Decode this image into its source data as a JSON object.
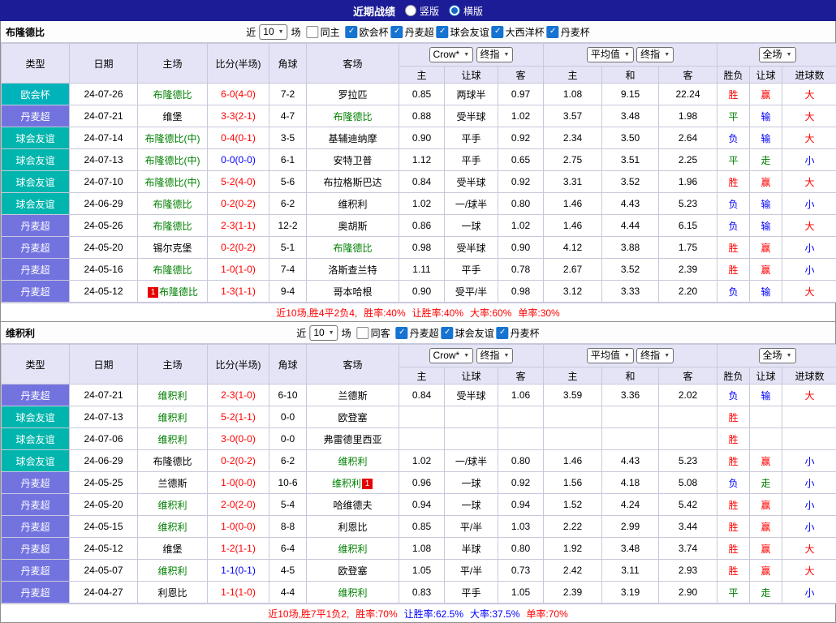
{
  "icons": {
    "dropdown_arrow": "▼",
    "check": "✓"
  },
  "topbar": {
    "title": "近期战绩",
    "layout_options": [
      {
        "label": "竖版",
        "selected": false
      },
      {
        "label": "横版",
        "selected": true
      }
    ]
  },
  "labels": {
    "near": "近",
    "matches": "场"
  },
  "table_header": {
    "col_type": "类型",
    "col_date": "日期",
    "col_home": "主场",
    "col_score": "比分(半场)",
    "col_corner": "角球",
    "col_away": "客场",
    "odds_select1": "Crow*",
    "odds_select2": "终指",
    "avg_select1": "平均值",
    "avg_select2": "终指",
    "scope_select": "全场",
    "odds_sub": [
      "主",
      "让球",
      "客"
    ],
    "avg_sub": [
      "主",
      "和",
      "客"
    ],
    "result_sub": [
      "胜负",
      "让球",
      "进球数"
    ]
  },
  "sections": [
    {
      "team": "布隆德比",
      "filter": {
        "period": "10",
        "same_label": "同主",
        "same_checked": false,
        "leagues": [
          {
            "label": "欧会杯",
            "checked": true
          },
          {
            "label": "丹麦超",
            "checked": true
          },
          {
            "label": "球会友谊",
            "checked": true
          },
          {
            "label": "大西洋杯",
            "checked": true
          },
          {
            "label": "丹麦杯",
            "checked": true
          }
        ]
      },
      "rows": [
        {
          "type": "欧会杯",
          "type_color": "#00b3bb",
          "date": "24-07-26",
          "home": "布隆德比",
          "home_color": "#008000",
          "score": "6-0(4-0)",
          "score_color": "#ff0000",
          "corner": "7-2",
          "away": "罗拉匹",
          "hc_home": "0.85",
          "handicap": "两球半",
          "hc_away": "0.97",
          "avg_home": "1.08",
          "avg_draw": "9.15",
          "avg_away": "22.24",
          "wdl": "胜",
          "wdl_color": "#ff0000",
          "hc_result": "赢",
          "hc_result_color": "#ff0000",
          "ou": "大",
          "ou_color": "#ff0000"
        },
        {
          "type": "丹麦超",
          "type_color": "#7373e0",
          "date": "24-07-21",
          "home": "维堡",
          "score": "3-3(2-1)",
          "score_color": "#ff0000",
          "corner": "4-7",
          "away": "布隆德比",
          "away_color": "#008000",
          "hc_home": "0.88",
          "handicap": "受半球",
          "hc_away": "1.02",
          "avg_home": "3.57",
          "avg_draw": "3.48",
          "avg_away": "1.98",
          "wdl": "平",
          "wdl_color": "#008000",
          "hc_result": "输",
          "hc_result_color": "#0000ff",
          "ou": "大",
          "ou_color": "#ff0000"
        },
        {
          "type": "球会友谊",
          "type_color": "#00b5ad",
          "date": "24-07-14",
          "home": "布隆德比(中)",
          "home_color": "#008000",
          "score": "0-4(0-1)",
          "score_color": "#ff0000",
          "corner": "3-5",
          "away": "基辅迪纳摩",
          "hc_home": "0.90",
          "handicap": "平手",
          "hc_away": "0.92",
          "avg_home": "2.34",
          "avg_draw": "3.50",
          "avg_away": "2.64",
          "wdl": "负",
          "wdl_color": "#0000ff",
          "hc_result": "输",
          "hc_result_color": "#0000ff",
          "ou": "大",
          "ou_color": "#ff0000"
        },
        {
          "type": "球会友谊",
          "type_color": "#00b5ad",
          "date": "24-07-13",
          "home": "布隆德比(中)",
          "home_color": "#008000",
          "score": "0-0(0-0)",
          "score_color": "#0000ff",
          "corner": "6-1",
          "away": "安特卫普",
          "hc_home": "1.12",
          "handicap": "平手",
          "hc_away": "0.65",
          "avg_home": "2.75",
          "avg_draw": "3.51",
          "avg_away": "2.25",
          "wdl": "平",
          "wdl_color": "#008000",
          "hc_result": "走",
          "hc_result_color": "#008000",
          "ou": "小",
          "ou_color": "#0000ff"
        },
        {
          "type": "球会友谊",
          "type_color": "#00b5ad",
          "date": "24-07-10",
          "home": "布隆德比(中)",
          "home_color": "#008000",
          "score": "5-2(4-0)",
          "score_color": "#ff0000",
          "corner": "5-6",
          "away": "布拉格斯巴达",
          "hc_home": "0.84",
          "handicap": "受半球",
          "hc_away": "0.92",
          "avg_home": "3.31",
          "avg_draw": "3.52",
          "avg_away": "1.96",
          "wdl": "胜",
          "wdl_color": "#ff0000",
          "hc_result": "赢",
          "hc_result_color": "#ff0000",
          "ou": "大",
          "ou_color": "#ff0000"
        },
        {
          "type": "球会友谊",
          "type_color": "#00b5ad",
          "date": "24-06-29",
          "home": "布隆德比",
          "home_color": "#008000",
          "score": "0-2(0-2)",
          "score_color": "#ff0000",
          "corner": "6-2",
          "away": "维积利",
          "hc_home": "1.02",
          "handicap": "一/球半",
          "hc_away": "0.80",
          "avg_home": "1.46",
          "avg_draw": "4.43",
          "avg_away": "5.23",
          "wdl": "负",
          "wdl_color": "#0000ff",
          "hc_result": "输",
          "hc_result_color": "#0000ff",
          "ou": "小",
          "ou_color": "#0000ff"
        },
        {
          "type": "丹麦超",
          "type_color": "#7373e0",
          "date": "24-05-26",
          "home": "布隆德比",
          "home_color": "#008000",
          "score": "2-3(1-1)",
          "score_color": "#ff0000",
          "corner": "12-2",
          "away": "奥胡斯",
          "hc_home": "0.86",
          "handicap": "一球",
          "hc_away": "1.02",
          "avg_home": "1.46",
          "avg_draw": "4.44",
          "avg_away": "6.15",
          "wdl": "负",
          "wdl_color": "#0000ff",
          "hc_result": "输",
          "hc_result_color": "#0000ff",
          "ou": "大",
          "ou_color": "#ff0000"
        },
        {
          "type": "丹麦超",
          "type_color": "#7373e0",
          "date": "24-05-20",
          "home": "锡尔克堡",
          "score": "0-2(0-2)",
          "score_color": "#ff0000",
          "corner": "5-1",
          "away": "布隆德比",
          "away_color": "#008000",
          "hc_home": "0.98",
          "handicap": "受半球",
          "hc_away": "0.90",
          "avg_home": "4.12",
          "avg_draw": "3.88",
          "avg_away": "1.75",
          "wdl": "胜",
          "wdl_color": "#ff0000",
          "hc_result": "赢",
          "hc_result_color": "#ff0000",
          "ou": "小",
          "ou_color": "#0000ff"
        },
        {
          "type": "丹麦超",
          "type_color": "#7373e0",
          "date": "24-05-16",
          "home": "布隆德比",
          "home_color": "#008000",
          "score": "1-0(1-0)",
          "score_color": "#ff0000",
          "corner": "7-4",
          "away": "洛斯查兰特",
          "hc_home": "1.11",
          "handicap": "平手",
          "hc_away": "0.78",
          "avg_home": "2.67",
          "avg_draw": "3.52",
          "avg_away": "2.39",
          "wdl": "胜",
          "wdl_color": "#ff0000",
          "hc_result": "赢",
          "hc_result_color": "#ff0000",
          "ou": "小",
          "ou_color": "#0000ff"
        },
        {
          "type": "丹麦超",
          "type_color": "#7373e0",
          "date": "24-05-12",
          "home_pre": "1",
          "home": "布隆德比",
          "home_color": "#008000",
          "score": "1-3(1-1)",
          "score_color": "#ff0000",
          "corner": "9-4",
          "away": "哥本哈根",
          "hc_home": "0.90",
          "handicap": "受平/半",
          "hc_away": "0.98",
          "avg_home": "3.12",
          "avg_draw": "3.33",
          "avg_away": "2.20",
          "wdl": "负",
          "wdl_color": "#0000ff",
          "hc_result": "输",
          "hc_result_color": "#0000ff",
          "ou": "大",
          "ou_color": "#ff0000"
        }
      ],
      "footer": [
        {
          "text": "近10场,胜4平2负4,",
          "color": "#ff0000"
        },
        {
          "text": "胜率:40%",
          "color": "#ff0000"
        },
        {
          "text": "让胜率:40%",
          "color": "#ff0000"
        },
        {
          "text": "大率:60%",
          "color": "#ff0000"
        },
        {
          "text": "单率:30%",
          "color": "#ff0000"
        }
      ]
    },
    {
      "team": "维积利",
      "filter": {
        "period": "10",
        "same_label": "同客",
        "same_checked": false,
        "leagues": [
          {
            "label": "丹麦超",
            "checked": true
          },
          {
            "label": "球会友谊",
            "checked": true
          },
          {
            "label": "丹麦杯",
            "checked": true
          }
        ]
      },
      "rows": [
        {
          "type": "丹麦超",
          "type_color": "#7373e0",
          "date": "24-07-21",
          "home": "维积利",
          "home_color": "#008000",
          "score": "2-3(1-0)",
          "score_color": "#ff0000",
          "corner": "6-10",
          "away": "兰德斯",
          "hc_home": "0.84",
          "handicap": "受半球",
          "hc_away": "1.06",
          "avg_home": "3.59",
          "avg_draw": "3.36",
          "avg_away": "2.02",
          "wdl": "负",
          "wdl_color": "#0000ff",
          "hc_result": "输",
          "hc_result_color": "#0000ff",
          "ou": "大",
          "ou_color": "#ff0000"
        },
        {
          "type": "球会友谊",
          "type_color": "#00b5ad",
          "date": "24-07-13",
          "home": "维积利",
          "home_color": "#008000",
          "score": "5-2(1-1)",
          "score_color": "#ff0000",
          "corner": "0-0",
          "away": "欧登塞",
          "wdl": "胜",
          "wdl_color": "#ff0000"
        },
        {
          "type": "球会友谊",
          "type_color": "#00b5ad",
          "date": "24-07-06",
          "home": "维积利",
          "home_color": "#008000",
          "score": "3-0(0-0)",
          "score_color": "#ff0000",
          "corner": "0-0",
          "away": "弗雷德里西亚",
          "wdl": "胜",
          "wdl_color": "#ff0000"
        },
        {
          "type": "球会友谊",
          "type_color": "#00b5ad",
          "date": "24-06-29",
          "home": "布隆德比",
          "score": "0-2(0-2)",
          "score_color": "#ff0000",
          "corner": "6-2",
          "away": "维积利",
          "away_color": "#008000",
          "hc_home": "1.02",
          "handicap": "一/球半",
          "hc_away": "0.80",
          "avg_home": "1.46",
          "avg_draw": "4.43",
          "avg_away": "5.23",
          "wdl": "胜",
          "wdl_color": "#ff0000",
          "hc_result": "赢",
          "hc_result_color": "#ff0000",
          "ou": "小",
          "ou_color": "#0000ff"
        },
        {
          "type": "丹麦超",
          "type_color": "#7373e0",
          "date": "24-05-25",
          "home": "兰德斯",
          "score": "1-0(0-0)",
          "score_color": "#ff0000",
          "corner": "10-6",
          "away": "维积利",
          "away_color": "#008000",
          "away_post": "1",
          "hc_home": "0.96",
          "handicap": "一球",
          "hc_away": "0.92",
          "avg_home": "1.56",
          "avg_draw": "4.18",
          "avg_away": "5.08",
          "wdl": "负",
          "wdl_color": "#0000ff",
          "hc_result": "走",
          "hc_result_color": "#008000",
          "ou": "小",
          "ou_color": "#0000ff"
        },
        {
          "type": "丹麦超",
          "type_color": "#7373e0",
          "date": "24-05-20",
          "home": "维积利",
          "home_color": "#008000",
          "score": "2-0(2-0)",
          "score_color": "#ff0000",
          "corner": "5-4",
          "away": "哈维德夫",
          "hc_home": "0.94",
          "handicap": "一球",
          "hc_away": "0.94",
          "avg_home": "1.52",
          "avg_draw": "4.24",
          "avg_away": "5.42",
          "wdl": "胜",
          "wdl_color": "#ff0000",
          "hc_result": "赢",
          "hc_result_color": "#ff0000",
          "ou": "小",
          "ou_color": "#0000ff"
        },
        {
          "type": "丹麦超",
          "type_color": "#7373e0",
          "date": "24-05-15",
          "home": "维积利",
          "home_color": "#008000",
          "score": "1-0(0-0)",
          "score_color": "#ff0000",
          "corner": "8-8",
          "away": "利恩比",
          "hc_home": "0.85",
          "handicap": "平/半",
          "hc_away": "1.03",
          "avg_home": "2.22",
          "avg_draw": "2.99",
          "avg_away": "3.44",
          "wdl": "胜",
          "wdl_color": "#ff0000",
          "hc_result": "赢",
          "hc_result_color": "#ff0000",
          "ou": "小",
          "ou_color": "#0000ff"
        },
        {
          "type": "丹麦超",
          "type_color": "#7373e0",
          "date": "24-05-12",
          "home": "维堡",
          "score": "1-2(1-1)",
          "score_color": "#ff0000",
          "corner": "6-4",
          "away": "维积利",
          "away_color": "#008000",
          "hc_home": "1.08",
          "handicap": "半球",
          "hc_away": "0.80",
          "avg_home": "1.92",
          "avg_draw": "3.48",
          "avg_away": "3.74",
          "wdl": "胜",
          "wdl_color": "#ff0000",
          "hc_result": "赢",
          "hc_result_color": "#ff0000",
          "ou": "大",
          "ou_color": "#ff0000"
        },
        {
          "type": "丹麦超",
          "type_color": "#7373e0",
          "date": "24-05-07",
          "home": "维积利",
          "home_color": "#008000",
          "score": "1-1(0-1)",
          "score_color": "#0000ff",
          "corner": "4-5",
          "away": "欧登塞",
          "hc_home": "1.05",
          "handicap": "平/半",
          "hc_away": "0.73",
          "avg_home": "2.42",
          "avg_draw": "3.11",
          "avg_away": "2.93",
          "wdl": "胜",
          "wdl_color": "#ff0000",
          "hc_result": "赢",
          "hc_result_color": "#ff0000",
          "ou": "大",
          "ou_color": "#ff0000"
        },
        {
          "type": "丹麦超",
          "type_color": "#7373e0",
          "date": "24-04-27",
          "home": "利恩比",
          "score": "1-1(1-0)",
          "score_color": "#ff0000",
          "corner": "4-4",
          "away": "维积利",
          "away_color": "#008000",
          "hc_home": "0.83",
          "handicap": "平手",
          "hc_away": "1.05",
          "avg_home": "2.39",
          "avg_draw": "3.19",
          "avg_away": "2.90",
          "wdl": "平",
          "wdl_color": "#008000",
          "hc_result": "走",
          "hc_result_color": "#008000",
          "ou": "小",
          "ou_color": "#0000ff"
        }
      ],
      "footer": [
        {
          "text": "近10场,胜7平1负2,",
          "color": "#ff0000"
        },
        {
          "text": "胜率:70%",
          "color": "#ff0000"
        },
        {
          "text": "让胜率:62.5%",
          "color": "#0000ff"
        },
        {
          "text": "大率:37.5%",
          "color": "#0000ff"
        },
        {
          "text": "单率:70%",
          "color": "#ff0000"
        }
      ]
    }
  ]
}
